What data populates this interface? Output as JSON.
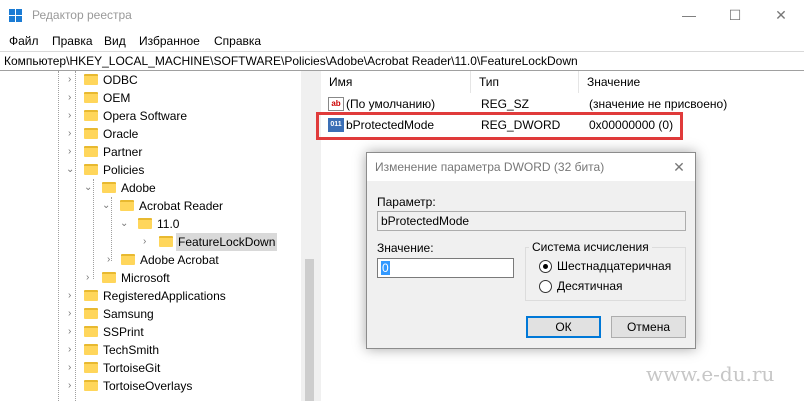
{
  "window": {
    "title": "Редактор реестра",
    "minimize": "—",
    "maximize": "☐",
    "close": "✕"
  },
  "menu": [
    "Файл",
    "Правка",
    "Вид",
    "Избранное",
    "Справка"
  ],
  "address": "Компьютер\\HKEY_LOCAL_MACHINE\\SOFTWARE\\Policies\\Adobe\\Acrobat Reader\\11.0\\FeatureLockDown",
  "tree": {
    "items": [
      {
        "label": "ODBC",
        "expanded": false
      },
      {
        "label": "OEM",
        "expanded": false
      },
      {
        "label": "Opera Software",
        "expanded": false
      },
      {
        "label": "Oracle",
        "expanded": false
      },
      {
        "label": "Partner",
        "expanded": false
      },
      {
        "label": "Policies",
        "expanded": true
      },
      {
        "label": "Adobe",
        "expanded": true
      },
      {
        "label": "Acrobat Reader",
        "expanded": true
      },
      {
        "label": "11.0",
        "expanded": true
      },
      {
        "label": "FeatureLockDown",
        "expanded": false,
        "selected": true
      },
      {
        "label": "Adobe Acrobat",
        "expanded": false
      },
      {
        "label": "Microsoft",
        "expanded": false
      },
      {
        "label": "RegisteredApplications",
        "expanded": false
      },
      {
        "label": "Samsung",
        "expanded": false
      },
      {
        "label": "SSPrint",
        "expanded": false
      },
      {
        "label": "TechSmith",
        "expanded": false
      },
      {
        "label": "TortoiseGit",
        "expanded": false
      },
      {
        "label": "TortoiseOverlays",
        "expanded": false
      }
    ]
  },
  "list": {
    "columns": [
      "Имя",
      "Тип",
      "Значение"
    ],
    "rows": [
      {
        "icon": "ab",
        "name": "(По умолчанию)",
        "type": "REG_SZ",
        "value": "(значение не присвоено)"
      },
      {
        "icon": "011",
        "name": "bProtectedMode",
        "type": "REG_DWORD",
        "value": "0x00000000 (0)"
      }
    ]
  },
  "dialog": {
    "title": "Изменение параметра DWORD (32 бита)",
    "close": "✕",
    "param_label": "Параметр:",
    "param_value": "bProtectedMode",
    "value_label": "Значение:",
    "value_value": "0",
    "base_label": "Система исчисления",
    "hex_label": "Шестнадцатеричная",
    "dec_label": "Десятичная",
    "base_selected": "hex",
    "ok": "ОК",
    "cancel": "Отмена"
  },
  "watermark": "www.e-du.ru",
  "colors": {
    "highlight": "#e03b3b",
    "folder": "#ffd65b",
    "accent": "#0078d7"
  }
}
